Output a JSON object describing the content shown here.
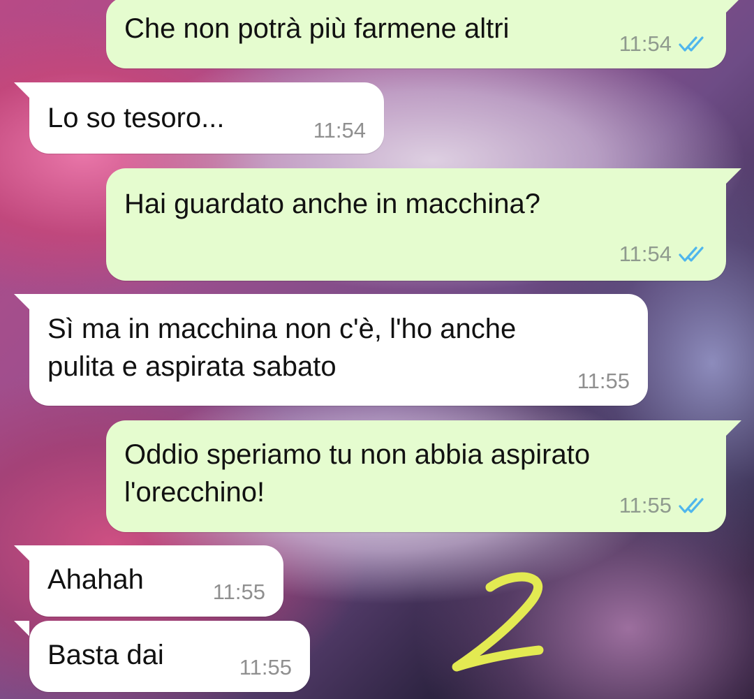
{
  "colors": {
    "incoming_bubble": "#ffffff",
    "outgoing_bubble": "#e5fccf",
    "read_ticks": "#4fb6ec",
    "timestamp": "#8f9a8e",
    "annotation_number": "#e3ea52"
  },
  "messages": [
    {
      "direction": "outgoing",
      "lines": [
        "Che non potrà più farmene altri"
      ],
      "time": "11:54",
      "status_icon": "double-check-read-icon"
    },
    {
      "direction": "incoming",
      "lines": [
        "Lo so tesoro..."
      ],
      "time": "11:54"
    },
    {
      "direction": "outgoing",
      "lines": [
        "Hai guardato anche in macchina?"
      ],
      "time": "11:54",
      "status_icon": "double-check-read-icon"
    },
    {
      "direction": "incoming",
      "lines": [
        "Sì ma in macchina non c'è, l'ho anche",
        "pulita e aspirata sabato"
      ],
      "time": "11:55"
    },
    {
      "direction": "outgoing",
      "lines": [
        "Oddio speriamo tu non abbia aspirato",
        "l'orecchino!"
      ],
      "time": "11:55",
      "status_icon": "double-check-read-icon"
    },
    {
      "direction": "incoming",
      "lines": [
        "Ahahah"
      ],
      "time": "11:55"
    },
    {
      "direction": "incoming",
      "lines": [
        "Basta dai"
      ],
      "time": "11:55"
    }
  ],
  "annotation": {
    "text": "2"
  }
}
